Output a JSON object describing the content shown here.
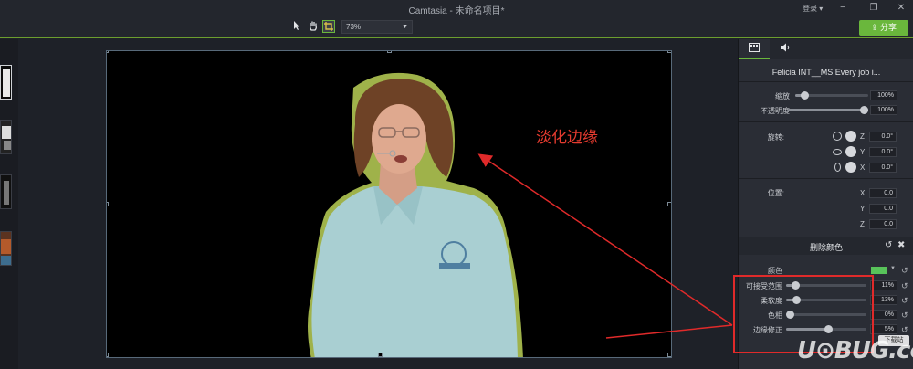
{
  "window": {
    "title": "Camtasia - 未命名项目*",
    "login_label": "登录 ▾",
    "controls": [
      "−",
      "❐",
      "✕"
    ]
  },
  "toolbar": {
    "tools": [
      "pointer-icon",
      "hand-icon",
      "crop-icon"
    ],
    "zoom": "73%",
    "share_label": "分享"
  },
  "canvas": {
    "annotation": "淡化边缘"
  },
  "properties": {
    "tabs": [
      "visual-properties-icon",
      "audio-icon"
    ],
    "media_title": "Felicia INT__MS Every job i...",
    "scale": {
      "label": "缩放",
      "value": "100%",
      "level": 0.12
    },
    "opacity": {
      "label": "不透明度",
      "value": "100%",
      "level": 1.0
    },
    "rotation": {
      "label": "旋转:",
      "z": {
        "axis": "Z",
        "value": "0.0°"
      },
      "y": {
        "axis": "Y",
        "value": "0.0°"
      },
      "x": {
        "axis": "X",
        "value": "0.0°"
      }
    },
    "position": {
      "label": "位置:",
      "x": {
        "axis": "X",
        "value": "0.0"
      },
      "y": {
        "axis": "Y",
        "value": "0.0"
      },
      "z": {
        "axis": "Z",
        "value": "0.0"
      }
    }
  },
  "chroma_key": {
    "title": "删除颜色",
    "color_label": "颜色",
    "color_value": "#58c35a",
    "tolerance": {
      "label": "可接受范围",
      "value": "11%",
      "level": 0.11
    },
    "softness": {
      "label": "柔软度",
      "value": "13%",
      "level": 0.13
    },
    "hue": {
      "label": "色相",
      "value": "0%",
      "level": 0.0
    },
    "defringe": {
      "label": "边缘修正",
      "value": "5%",
      "level": 0.52
    }
  },
  "watermark": {
    "text": "U⊙BUG.com",
    "badge": "下载站"
  }
}
